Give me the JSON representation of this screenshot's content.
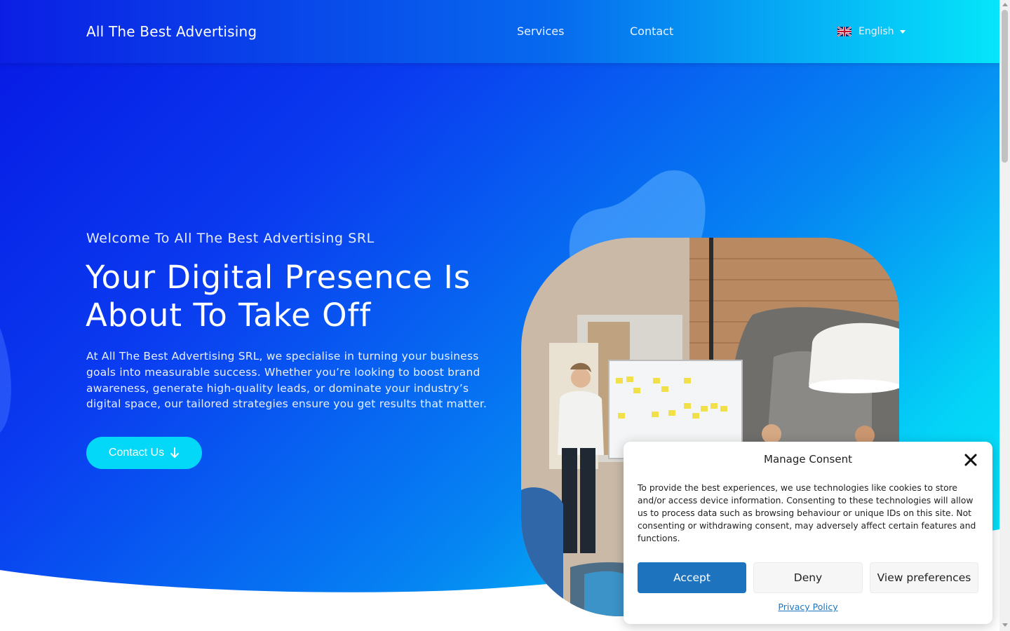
{
  "brand": {
    "name": "All The Best Advertising"
  },
  "nav": {
    "items": [
      {
        "label": "Services"
      },
      {
        "label": "Contact"
      }
    ],
    "language": {
      "label": "English",
      "flag_icon": "uk-flag-icon"
    }
  },
  "hero": {
    "welcome": "Welcome To All The Best Advertising SRL",
    "headline": "Your Digital Presence Is About To Take Off",
    "description": "At All The Best Advertising SRL, we specialise in turning your business goals into measurable success. Whether you’re looking to boost brand awareness, generate high-quality leads, or dominate your industry’s digital space, our tailored strategies ensure you get results that matter.",
    "cta_label": "Contact Us",
    "cta_icon": "arrow-down-icon"
  },
  "consent": {
    "title": "Manage Consent",
    "text": "To provide the best experiences, we use technologies like cookies to store and/or access device information. Consenting to these technologies will allow us to process data such as browsing behaviour or unique IDs on this site. Not consenting or withdrawing consent, may adversely affect certain features and functions.",
    "accept_label": "Accept",
    "deny_label": "Deny",
    "preferences_label": "View preferences",
    "privacy_label": "Privacy Policy"
  },
  "colors": {
    "gradient_start": "#0717e3",
    "gradient_end": "#05e8fb",
    "cta": "#03d8f8",
    "accept": "#1e73be",
    "link": "#1e73be"
  }
}
